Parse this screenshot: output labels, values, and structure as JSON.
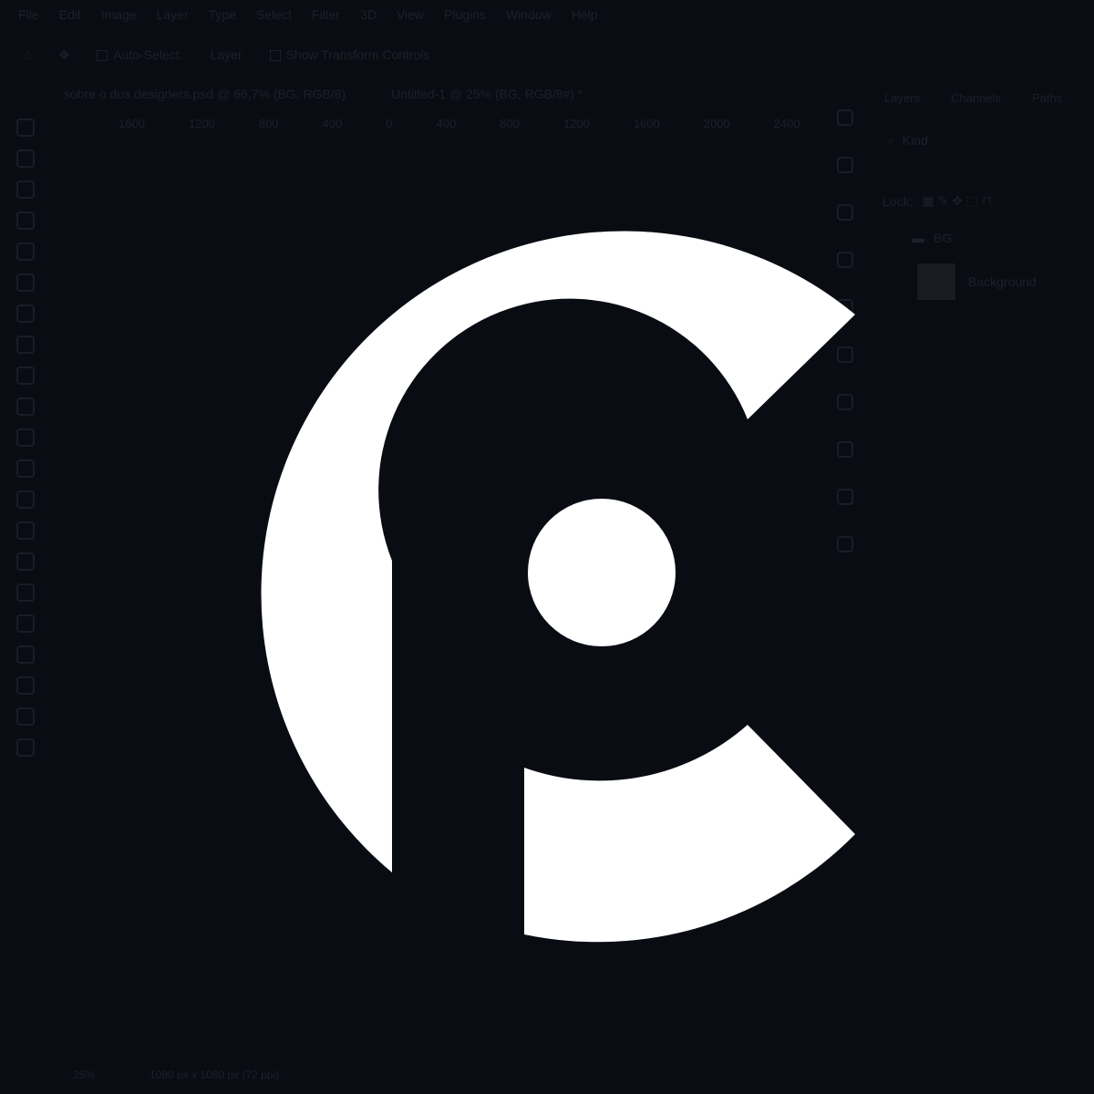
{
  "colors": {
    "background": "#0a0c13",
    "ghost_ui": "#1d2029",
    "logo": "#ffffff"
  },
  "menu": [
    "File",
    "Edit",
    "Image",
    "Layer",
    "Type",
    "Select",
    "Filter",
    "3D",
    "View",
    "Plugins",
    "Window",
    "Help"
  ],
  "options": {
    "auto_select": "Auto-Select:",
    "layer": "Layer",
    "show_transform": "Show Transform Controls"
  },
  "tabs": [
    "sobre o dos designers.psd @ 66,7% (BG, RGB/8)",
    "Untitled-1 @ 25% (BG, RGB/8#) *"
  ],
  "ruler": [
    "1600",
    "1200",
    "800",
    "400",
    "0",
    "400",
    "800",
    "1200",
    "1600",
    "2000",
    "2400"
  ],
  "panel": {
    "tabs": [
      "Layers",
      "Channels",
      "Paths"
    ],
    "search": "Kind",
    "lock": "Lock:",
    "group": "BG",
    "layer": "Background"
  },
  "status": {
    "zoom": "25%",
    "doc": "1080 px x 1080 px (72 ppi)"
  },
  "icons": [
    "move-icon",
    "marquee-icon",
    "lasso-icon",
    "wand-icon",
    "crop-icon",
    "frame-icon",
    "eyedropper-icon",
    "healing-icon",
    "brush-icon",
    "stamp-icon",
    "history-brush-icon",
    "eraser-icon",
    "gradient-icon",
    "blur-icon",
    "dodge-icon",
    "pen-icon",
    "type-icon",
    "path-select-icon",
    "shape-icon",
    "hand-icon",
    "zoom-icon"
  ]
}
